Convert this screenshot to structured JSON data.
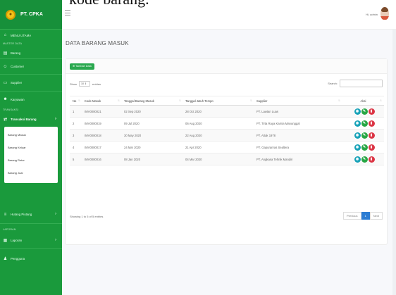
{
  "caption_fragment": "kode barang.",
  "brand": {
    "name": "PT. CPKA"
  },
  "sidebar": {
    "menu_utama": "MENU UTAMA",
    "heading_master": "MASTER DATA",
    "barang": "Barang",
    "customer": "Customer",
    "supplier": "Supplier",
    "karyawan": "Karyawan",
    "heading_transaksi": "TRANSAKSI",
    "transaksi_barang": "Transaksi Barang",
    "sub": [
      "Barang Masuk",
      "Barang Keluar",
      "Barang Retur",
      "Barang Jual"
    ],
    "hutang_piutang": "Hutang Piutang",
    "heading_laporan": "LAPORAN",
    "laporan": "Laporan",
    "pengguna": "Pengguna"
  },
  "topbar": {
    "admin": "Hi, admin"
  },
  "main": {
    "title": "DATA BARANG MASUK",
    "add_button": "Tambah Data",
    "show_label": "Show",
    "show_value": "10",
    "entries_label": "entries",
    "search_label": "Search:",
    "columns": [
      "No",
      "Kode Masuk",
      "Tanggal Barang Masuk",
      "Tanggal Jatuh Tempo",
      "Supplier",
      "Aksi"
    ],
    "rows": [
      {
        "no": "1",
        "kode": "IMV0000021",
        "tgl_masuk": "02 Sep 2020",
        "tgl_tempo": "28 Oct 2020",
        "supplier": "PT. Lawtan Luas"
      },
      {
        "no": "2",
        "kode": "IMV0000019",
        "tgl_masuk": "09 Jul 2020",
        "tgl_tempo": "06 Aug 2020",
        "supplier": "PT. Tirta Raya Karnia Manunggal"
      },
      {
        "no": "3",
        "kode": "IMV0000018",
        "tgl_masuk": "30 May 2020",
        "tgl_tempo": "22 Aug 2020",
        "supplier": "PT. Attak 1978"
      },
      {
        "no": "4",
        "kode": "IMV0000017",
        "tgl_masuk": "24 Mar 2020",
        "tgl_tempo": "21 Apr 2020",
        "supplier": "PT. Gapuranras Sealtera"
      },
      {
        "no": "5",
        "kode": "IMV0000016",
        "tgl_masuk": "08 Jan 2020",
        "tgl_tempo": "04 Mar 2020",
        "supplier": "PT. Angkasa Tehnik Mandiri"
      }
    ],
    "info": "Showing 1 to 5 of 5 entries",
    "pagination": {
      "previous": "Previous",
      "current": "1",
      "next": "Next"
    }
  },
  "colors": {
    "sidebar": "#1a9a3c",
    "accent": "#2aa84f",
    "page_active": "#2b7cd3",
    "view": "#17a2b8",
    "edit": "#28a745",
    "delete": "#dc3545"
  }
}
